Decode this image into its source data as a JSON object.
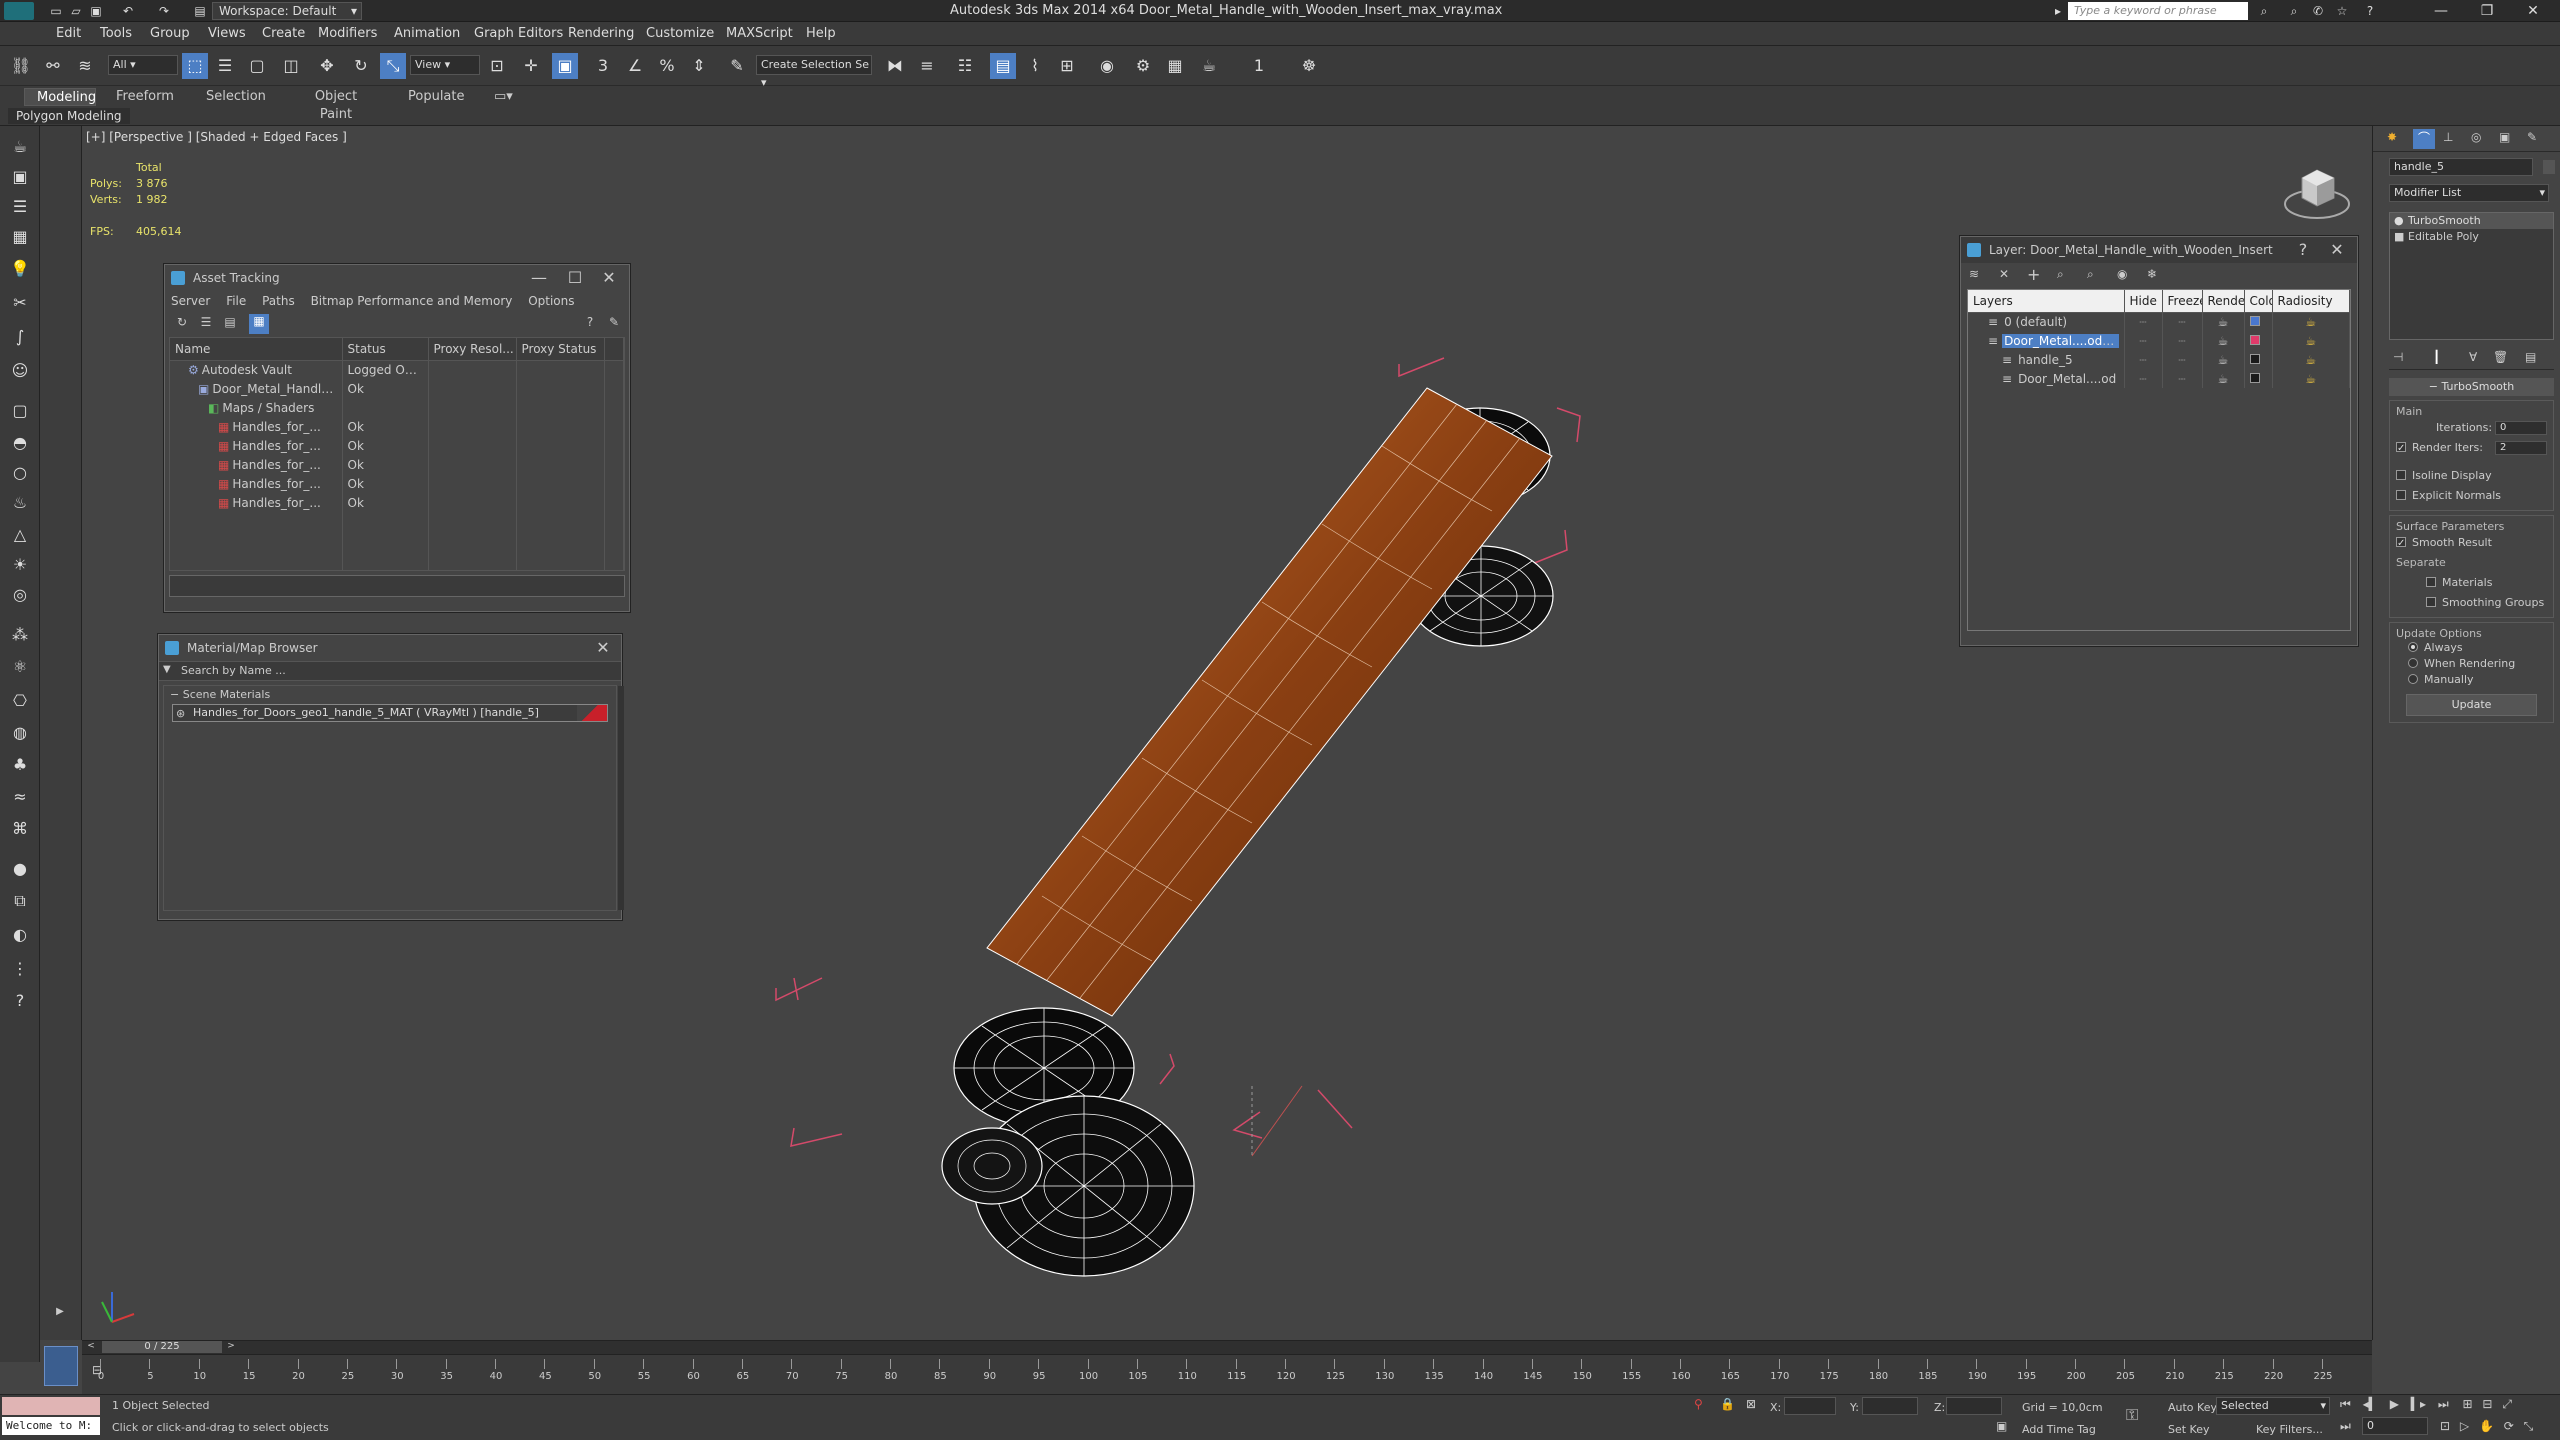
{
  "title_bar": {
    "workspace": "Workspace: Default",
    "title": "Autodesk 3ds Max  2014 x64     Door_Metal_Handle_with_Wooden_Insert_max_vray.max",
    "search_placeholder": "Type a keyword or phrase"
  },
  "menu": [
    "Edit",
    "Tools",
    "Group",
    "Views",
    "Create",
    "Modifiers",
    "Animation",
    "Graph Editors",
    "Rendering",
    "Customize",
    "MAXScript",
    "Help"
  ],
  "toolbar": {
    "filter": "All",
    "ref_coord": "View",
    "selection_set": "Create Selection Se",
    "angle_snap": "1"
  },
  "ribbon": {
    "tabs": [
      "Modeling",
      "Freeform",
      "Selection",
      "Object Paint",
      "Populate"
    ],
    "active": "Modeling",
    "sub": "Polygon Modeling"
  },
  "viewport": {
    "label": "[+] [Perspective ] [Shaded + Edged Faces ]",
    "stats": {
      "total": "Total",
      "polys_label": "Polys:",
      "polys": "3 876",
      "verts_label": "Verts:",
      "verts": "1 982",
      "fps_label": "FPS:",
      "fps": "405,614"
    }
  },
  "asset_tracking": {
    "title": "Asset Tracking",
    "menu": [
      "Server",
      "File",
      "Paths",
      "Bitmap Performance and Memory",
      "Options"
    ],
    "columns": [
      "Name",
      "Status",
      "Proxy Resol...",
      "Proxy Status"
    ],
    "rows": [
      {
        "name": "Autodesk Vault",
        "status": "Logged Out ...",
        "indent": 1
      },
      {
        "name": "Door_Metal_Handle...",
        "status": "Ok",
        "indent": 2
      },
      {
        "name": "Maps / Shaders",
        "status": "",
        "indent": 3
      },
      {
        "name": "Handles_for_...",
        "status": "Ok",
        "indent": 4
      },
      {
        "name": "Handles_for_...",
        "status": "Ok",
        "indent": 4
      },
      {
        "name": "Handles_for_...",
        "status": "Ok",
        "indent": 4
      },
      {
        "name": "Handles_for_...",
        "status": "Ok",
        "indent": 4
      },
      {
        "name": "Handles_for_...",
        "status": "Ok",
        "indent": 4
      }
    ]
  },
  "material_browser": {
    "title": "Material/Map Browser",
    "search_placeholder": "Search by Name ...",
    "group": "Scene Materials",
    "item": "Handles_for_Doors_geo1_handle_5_MAT ( VRayMtl ) [handle_5]"
  },
  "layer_panel": {
    "title": "Layer: Door_Metal_Handle_with_Wooden_Insert",
    "columns": [
      "Layers",
      "Hide",
      "Freeze",
      "Render",
      "Color",
      "Radiosity"
    ],
    "rows": [
      {
        "name": "0 (default)",
        "color": "#4a78d0",
        "indent": 1,
        "selected": false
      },
      {
        "name": "Door_Metal....oden",
        "color": "#e03a6a",
        "indent": 1,
        "selected": true
      },
      {
        "name": "handle_5",
        "color": "#1a1a1a",
        "indent": 2,
        "selected": false
      },
      {
        "name": "Door_Metal....od",
        "color": "#1a1a1a",
        "indent": 2,
        "selected": false
      }
    ]
  },
  "command_panel": {
    "object_name": "handle_5",
    "modifier_list": "Modifier List",
    "stack": [
      "TurboSmooth",
      "Editable Poly"
    ],
    "rollout": "TurboSmooth",
    "main": "Main",
    "iterations_label": "Iterations:",
    "iterations": "0",
    "render_iters_label": "Render Iters:",
    "render_iters": "2",
    "isoline": "Isoline Display",
    "explicit": "Explicit Normals",
    "surface": "Surface Parameters",
    "smooth_result": "Smooth Result",
    "separate": "Separate",
    "materials": "Materials",
    "smoothing_groups": "Smoothing Groups",
    "update_options": "Update Options",
    "always": "Always",
    "when_rendering": "When Rendering",
    "manually": "Manually",
    "update": "Update"
  },
  "timeline": {
    "frame": "0 / 225",
    "ticks": [
      "0",
      "5",
      "10",
      "15",
      "20",
      "25",
      "30",
      "35",
      "40",
      "45",
      "50",
      "55",
      "60",
      "65",
      "70",
      "75",
      "80",
      "85",
      "90",
      "95",
      "100",
      "105",
      "110",
      "115",
      "120",
      "125",
      "130",
      "135",
      "140",
      "145",
      "150",
      "155",
      "160",
      "165",
      "170",
      "175",
      "180",
      "185",
      "190",
      "195",
      "200",
      "205",
      "210",
      "215",
      "220",
      "225"
    ]
  },
  "status": {
    "welcome": "Welcome to M:",
    "selected": "1 Object Selected",
    "hint": "Click or click-and-drag to select objects",
    "x": "X:",
    "y": "Y:",
    "z": "Z:",
    "grid": "Grid = 10,0cm",
    "add_time_tag": "Add Time Tag",
    "auto_key": "Auto Key",
    "set_key": "Set Key",
    "selected_mode": "Selected",
    "key_filters": "Key Filters...",
    "frame_field": "0"
  },
  "colors": {
    "accent": "#4d7fc4",
    "stats": "#e8e36a",
    "wood": "#a0521f",
    "wire": "#ffffff",
    "bbox": "#d44a6a"
  }
}
